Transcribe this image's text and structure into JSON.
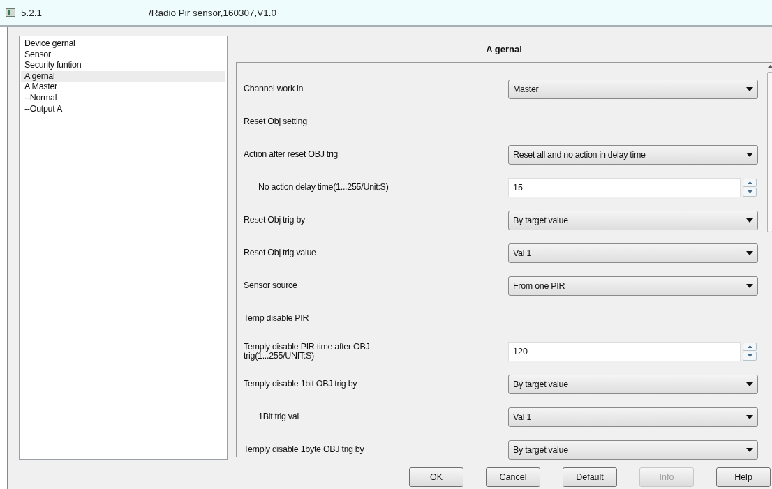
{
  "window": {
    "title_number": "5.2.1",
    "title": "/Radio Pir sensor,160307,V1.0"
  },
  "sidebar": {
    "items": [
      {
        "label": "Device gernal",
        "selected": false
      },
      {
        "label": "Sensor",
        "selected": false
      },
      {
        "label": "Security funtion",
        "selected": false
      },
      {
        "label": "A gernal",
        "selected": true
      },
      {
        "label": "A Master",
        "selected": false
      },
      {
        "label": "--Normal",
        "selected": false
      },
      {
        "label": "--Output A",
        "selected": false
      }
    ]
  },
  "panel": {
    "title": "A gernal",
    "rows": [
      {
        "kind": "select",
        "label": "Channel work in",
        "value": "Master",
        "indented": false
      },
      {
        "kind": "heading",
        "label": "Reset Obj setting",
        "indented": false
      },
      {
        "kind": "select",
        "label": "Action after reset OBJ trig",
        "value": "Reset all and no action in delay time",
        "indented": false
      },
      {
        "kind": "number",
        "label": "No action delay time(1...255/Unit:S)",
        "value": "15",
        "indented": true
      },
      {
        "kind": "select",
        "label": "Reset Obj trig by",
        "value": "By target value",
        "indented": false
      },
      {
        "kind": "select",
        "label": "Reset Obj trig value",
        "value": "Val 1",
        "indented": false
      },
      {
        "kind": "select",
        "label": "Sensor source",
        "value": "From one PIR",
        "indented": false
      },
      {
        "kind": "heading",
        "label": "Temp disable PIR",
        "indented": false
      },
      {
        "kind": "number",
        "label": "Temply disable PIR time after OBJ trig(1...255/UNIT:S)",
        "value": "120",
        "indented": false
      },
      {
        "kind": "select",
        "label": "Temply disable 1bit OBJ trig by",
        "value": "By target value",
        "indented": false
      },
      {
        "kind": "select",
        "label": "1Bit trig val",
        "value": "Val 1",
        "indented": true
      },
      {
        "kind": "select",
        "label": "Temply disable 1byte OBJ trig by",
        "value": "By target value",
        "indented": false
      }
    ]
  },
  "buttons": [
    {
      "label": "OK",
      "disabled": false
    },
    {
      "label": "Cancel",
      "disabled": false
    },
    {
      "label": "Default",
      "disabled": false
    },
    {
      "label": "Info",
      "disabled": true
    },
    {
      "label": "Help",
      "disabled": false
    }
  ]
}
